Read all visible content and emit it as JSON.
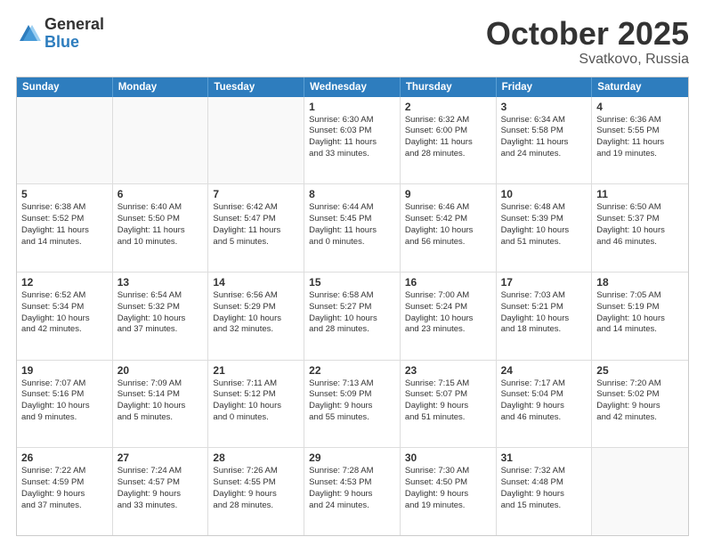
{
  "logo": {
    "general": "General",
    "blue": "Blue"
  },
  "title": "October 2025",
  "location": "Svatkovo, Russia",
  "days_of_week": [
    "Sunday",
    "Monday",
    "Tuesday",
    "Wednesday",
    "Thursday",
    "Friday",
    "Saturday"
  ],
  "weeks": [
    [
      {
        "day": "",
        "lines": [],
        "empty": true
      },
      {
        "day": "",
        "lines": [],
        "empty": true
      },
      {
        "day": "",
        "lines": [],
        "empty": true
      },
      {
        "day": "1",
        "lines": [
          "Sunrise: 6:30 AM",
          "Sunset: 6:03 PM",
          "Daylight: 11 hours",
          "and 33 minutes."
        ]
      },
      {
        "day": "2",
        "lines": [
          "Sunrise: 6:32 AM",
          "Sunset: 6:00 PM",
          "Daylight: 11 hours",
          "and 28 minutes."
        ]
      },
      {
        "day": "3",
        "lines": [
          "Sunrise: 6:34 AM",
          "Sunset: 5:58 PM",
          "Daylight: 11 hours",
          "and 24 minutes."
        ]
      },
      {
        "day": "4",
        "lines": [
          "Sunrise: 6:36 AM",
          "Sunset: 5:55 PM",
          "Daylight: 11 hours",
          "and 19 minutes."
        ]
      }
    ],
    [
      {
        "day": "5",
        "lines": [
          "Sunrise: 6:38 AM",
          "Sunset: 5:52 PM",
          "Daylight: 11 hours",
          "and 14 minutes."
        ]
      },
      {
        "day": "6",
        "lines": [
          "Sunrise: 6:40 AM",
          "Sunset: 5:50 PM",
          "Daylight: 11 hours",
          "and 10 minutes."
        ]
      },
      {
        "day": "7",
        "lines": [
          "Sunrise: 6:42 AM",
          "Sunset: 5:47 PM",
          "Daylight: 11 hours",
          "and 5 minutes."
        ]
      },
      {
        "day": "8",
        "lines": [
          "Sunrise: 6:44 AM",
          "Sunset: 5:45 PM",
          "Daylight: 11 hours",
          "and 0 minutes."
        ]
      },
      {
        "day": "9",
        "lines": [
          "Sunrise: 6:46 AM",
          "Sunset: 5:42 PM",
          "Daylight: 10 hours",
          "and 56 minutes."
        ]
      },
      {
        "day": "10",
        "lines": [
          "Sunrise: 6:48 AM",
          "Sunset: 5:39 PM",
          "Daylight: 10 hours",
          "and 51 minutes."
        ]
      },
      {
        "day": "11",
        "lines": [
          "Sunrise: 6:50 AM",
          "Sunset: 5:37 PM",
          "Daylight: 10 hours",
          "and 46 minutes."
        ]
      }
    ],
    [
      {
        "day": "12",
        "lines": [
          "Sunrise: 6:52 AM",
          "Sunset: 5:34 PM",
          "Daylight: 10 hours",
          "and 42 minutes."
        ]
      },
      {
        "day": "13",
        "lines": [
          "Sunrise: 6:54 AM",
          "Sunset: 5:32 PM",
          "Daylight: 10 hours",
          "and 37 minutes."
        ]
      },
      {
        "day": "14",
        "lines": [
          "Sunrise: 6:56 AM",
          "Sunset: 5:29 PM",
          "Daylight: 10 hours",
          "and 32 minutes."
        ]
      },
      {
        "day": "15",
        "lines": [
          "Sunrise: 6:58 AM",
          "Sunset: 5:27 PM",
          "Daylight: 10 hours",
          "and 28 minutes."
        ]
      },
      {
        "day": "16",
        "lines": [
          "Sunrise: 7:00 AM",
          "Sunset: 5:24 PM",
          "Daylight: 10 hours",
          "and 23 minutes."
        ]
      },
      {
        "day": "17",
        "lines": [
          "Sunrise: 7:03 AM",
          "Sunset: 5:21 PM",
          "Daylight: 10 hours",
          "and 18 minutes."
        ]
      },
      {
        "day": "18",
        "lines": [
          "Sunrise: 7:05 AM",
          "Sunset: 5:19 PM",
          "Daylight: 10 hours",
          "and 14 minutes."
        ]
      }
    ],
    [
      {
        "day": "19",
        "lines": [
          "Sunrise: 7:07 AM",
          "Sunset: 5:16 PM",
          "Daylight: 10 hours",
          "and 9 minutes."
        ]
      },
      {
        "day": "20",
        "lines": [
          "Sunrise: 7:09 AM",
          "Sunset: 5:14 PM",
          "Daylight: 10 hours",
          "and 5 minutes."
        ]
      },
      {
        "day": "21",
        "lines": [
          "Sunrise: 7:11 AM",
          "Sunset: 5:12 PM",
          "Daylight: 10 hours",
          "and 0 minutes."
        ]
      },
      {
        "day": "22",
        "lines": [
          "Sunrise: 7:13 AM",
          "Sunset: 5:09 PM",
          "Daylight: 9 hours",
          "and 55 minutes."
        ]
      },
      {
        "day": "23",
        "lines": [
          "Sunrise: 7:15 AM",
          "Sunset: 5:07 PM",
          "Daylight: 9 hours",
          "and 51 minutes."
        ]
      },
      {
        "day": "24",
        "lines": [
          "Sunrise: 7:17 AM",
          "Sunset: 5:04 PM",
          "Daylight: 9 hours",
          "and 46 minutes."
        ]
      },
      {
        "day": "25",
        "lines": [
          "Sunrise: 7:20 AM",
          "Sunset: 5:02 PM",
          "Daylight: 9 hours",
          "and 42 minutes."
        ]
      }
    ],
    [
      {
        "day": "26",
        "lines": [
          "Sunrise: 7:22 AM",
          "Sunset: 4:59 PM",
          "Daylight: 9 hours",
          "and 37 minutes."
        ]
      },
      {
        "day": "27",
        "lines": [
          "Sunrise: 7:24 AM",
          "Sunset: 4:57 PM",
          "Daylight: 9 hours",
          "and 33 minutes."
        ]
      },
      {
        "day": "28",
        "lines": [
          "Sunrise: 7:26 AM",
          "Sunset: 4:55 PM",
          "Daylight: 9 hours",
          "and 28 minutes."
        ]
      },
      {
        "day": "29",
        "lines": [
          "Sunrise: 7:28 AM",
          "Sunset: 4:53 PM",
          "Daylight: 9 hours",
          "and 24 minutes."
        ]
      },
      {
        "day": "30",
        "lines": [
          "Sunrise: 7:30 AM",
          "Sunset: 4:50 PM",
          "Daylight: 9 hours",
          "and 19 minutes."
        ]
      },
      {
        "day": "31",
        "lines": [
          "Sunrise: 7:32 AM",
          "Sunset: 4:48 PM",
          "Daylight: 9 hours",
          "and 15 minutes."
        ]
      },
      {
        "day": "",
        "lines": [],
        "empty": true
      }
    ]
  ]
}
